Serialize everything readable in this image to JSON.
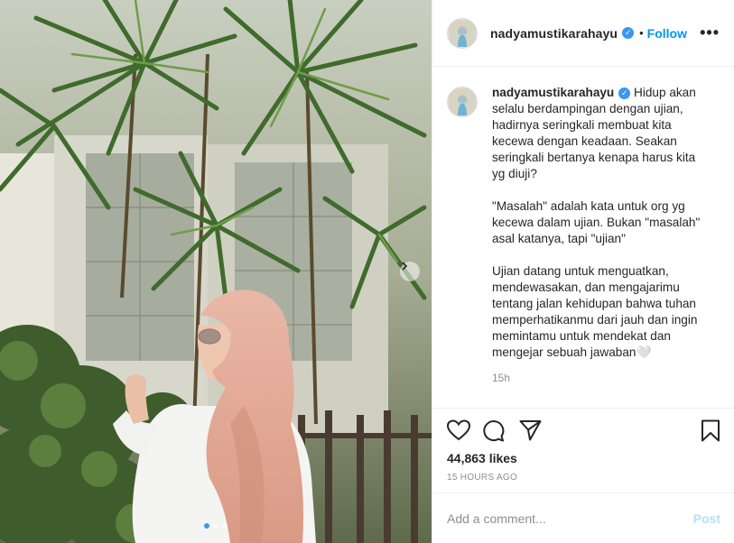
{
  "post": {
    "username": "nadyamustikarahayu",
    "verified_badge_icon": "check-icon",
    "separator": "•",
    "follow_label": "Follow",
    "more_icon": "more-dots-icon",
    "more_glyph": "•••",
    "carousel": {
      "slide_count": 3,
      "active_index": 0,
      "next_icon": "chevron-right-icon"
    }
  },
  "caption": {
    "username": "nadyamustikarahayu",
    "paragraphs": [
      "Hidup akan selalu berdampingan dengan ujian, hadirnya seringkali membuat kita kecewa dengan keadaan. Seakan seringkali bertanya kenapa harus kita yg diuji?",
      "\"Masalah\" adalah kata untuk org yg kecewa dalam ujian. Bukan \"masalah\" asal katanya, tapi \"ujian\"",
      "Ujian datang untuk menguatkan, mendewasakan, dan mengajarimu tentang jalan kehidupan bahwa tuhan memperhatikanmu dari jauh dan ingin memintamu untuk mendekat dan mengejar sebuah jawaban🤍"
    ],
    "time_ago": "15h"
  },
  "actions": {
    "like_icon": "heart-icon",
    "comment_icon": "comment-icon",
    "share_icon": "paper-plane-icon",
    "save_icon": "bookmark-icon",
    "likes": "44,863 likes",
    "posted": "15 HOURS AGO"
  },
  "comment_box": {
    "placeholder": "Add a comment...",
    "post_label": "Post"
  },
  "colors": {
    "accent": "#0095f6",
    "verified": "#3897f0",
    "post_disabled": "#b2dffc",
    "muted": "#8e8e8e"
  }
}
